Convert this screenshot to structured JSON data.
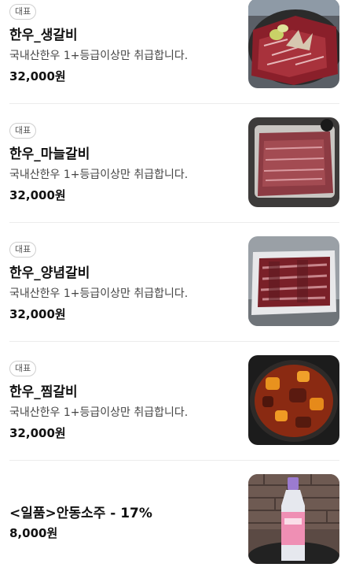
{
  "menu": {
    "items": [
      {
        "badge": "대표",
        "name": "한우_생갈비",
        "description": "국내산한우 1+등급이상만 취급합니다.",
        "price": "32,000원",
        "image": "raw-beef-ribs-photo"
      },
      {
        "badge": "대표",
        "name": "한우_마늘갈비",
        "description": "국내산한우 1+등급이상만 취급합니다.",
        "price": "32,000원",
        "image": "garlic-beef-ribs-photo"
      },
      {
        "badge": "대표",
        "name": "한우_양념갈비",
        "description": "국내산한우 1+등급이상만 취급합니다.",
        "price": "32,000원",
        "image": "marinated-beef-ribs-photo"
      },
      {
        "badge": "대표",
        "name": "한우_찜갈비",
        "description": "국내산한우 1+등급이상만 취급합니다.",
        "price": "32,000원",
        "image": "braised-short-ribs-photo"
      },
      {
        "name": "<일품>안동소주 - 17%",
        "price": "8,000원",
        "image": "andong-soju-bottle-photo"
      }
    ]
  }
}
